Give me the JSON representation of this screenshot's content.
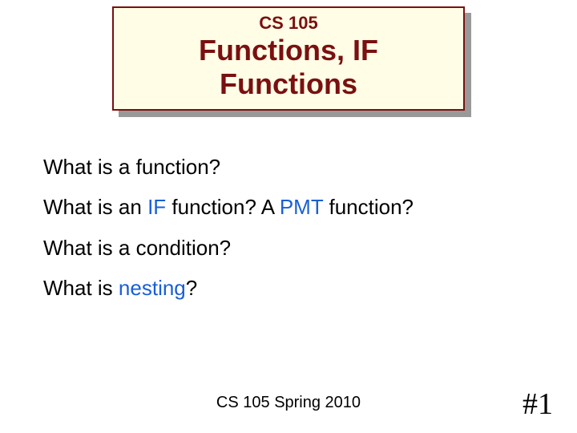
{
  "header": {
    "course_code": "CS 105",
    "title": "Functions, IF Functions"
  },
  "lines": {
    "l1": "What is a function?",
    "l2_a": "What is an ",
    "l2_kw1": "IF",
    "l2_b": " function? A ",
    "l2_kw2": "PMT",
    "l2_c": " function?",
    "l3": "What is a condition?",
    "l4_a": "What is ",
    "l4_kw": "nesting",
    "l4_b": "?"
  },
  "footer": {
    "text": "CS 105 Spring 2010",
    "slide_number": "#1"
  }
}
